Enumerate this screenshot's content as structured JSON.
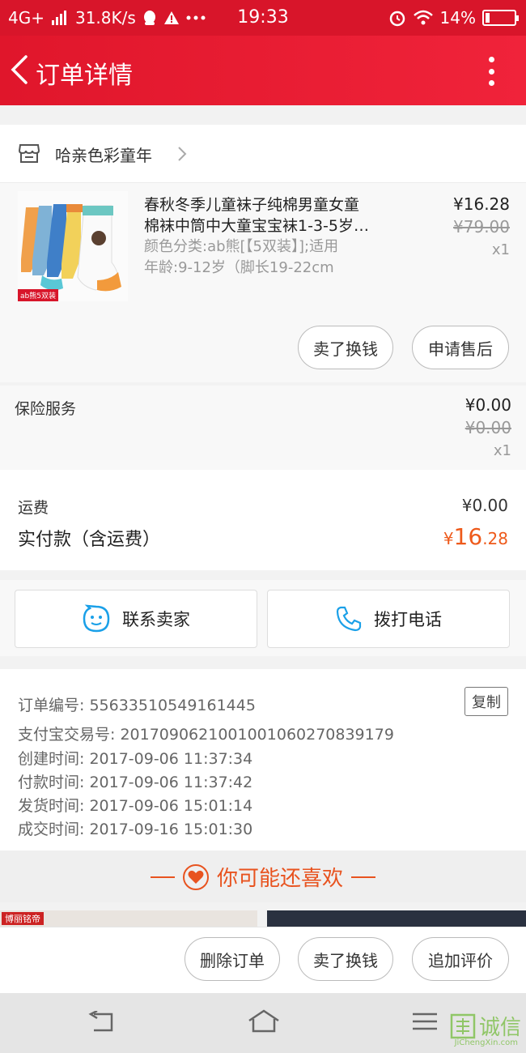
{
  "status_bar": {
    "network": "4G+",
    "speed": "31.8K/s",
    "time": "19:33",
    "battery": "14%",
    "battery_level": 0.14
  },
  "nav": {
    "title": "订单详情"
  },
  "shop": {
    "name": "哈亲色彩童年"
  },
  "product": {
    "title_line1": "春秋冬季儿童袜子纯棉男童女童",
    "title_line2": "棉袜中筒中大童宝宝袜1-3-5岁…",
    "spec_line1": "颜色分类:ab熊[【5双装】];适用",
    "spec_line2": "年龄:9-12岁（脚长19-22cm",
    "image_tag": "ab熊5双装",
    "price": "¥16.28",
    "original_price": "¥79.00",
    "qty": "x1",
    "btn_sell": "卖了换钱",
    "btn_after_sale": "申请售后"
  },
  "insurance": {
    "label": "保险服务",
    "price": "¥0.00",
    "original_price": "¥0.00",
    "qty": "x1"
  },
  "totals": {
    "shipping_label": "运费",
    "shipping_value": "¥0.00",
    "paid_label": "实付款（含运费）",
    "paid_currency": "¥",
    "paid_int": "16",
    "paid_dec": ".28"
  },
  "contact": {
    "seller": "联系卖家",
    "call": "拨打电话"
  },
  "order_info": {
    "order_no": "订单编号: 55633510549161445",
    "copy": "复制",
    "alipay_no": "支付宝交易号: 2017090621001001060270839179",
    "created": "创建时间: 2017-09-06 11:37:34",
    "paid": "付款时间: 2017-09-06 11:37:42",
    "shipped": "发货时间: 2017-09-06 15:01:14",
    "completed": "成交时间: 2017-09-16 15:01:30"
  },
  "recommend": {
    "title": "你可能还喜欢",
    "peek_tag": "博丽铭帝"
  },
  "bottom_actions": {
    "delete": "删除订单",
    "sell": "卖了换钱",
    "review": "追加评价"
  },
  "watermark": {
    "text": "诚信",
    "sub": "JiChengXin.com"
  },
  "colors": {
    "brand_red": "#d8152a",
    "price_orange": "#ee5a1b",
    "accent_blue": "#1aa0e8"
  }
}
